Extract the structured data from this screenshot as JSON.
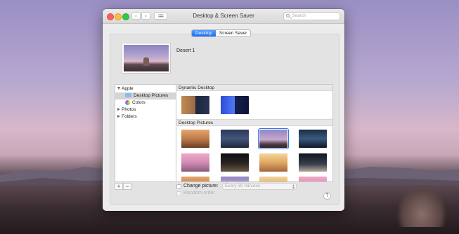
{
  "window": {
    "title": "Desktop & Screen Saver"
  },
  "search": {
    "placeholder": "Search"
  },
  "tabs": [
    {
      "label": "Desktop",
      "active": true
    },
    {
      "label": "Screen Saver",
      "active": false
    }
  ],
  "preview": {
    "name": "Desert 1"
  },
  "sidebar": {
    "groups": [
      {
        "label": "Apple",
        "expanded": true,
        "children": [
          {
            "label": "Desktop Pictures",
            "selected": true
          },
          {
            "label": "Colors"
          }
        ]
      },
      {
        "label": "Photos",
        "expanded": false
      },
      {
        "label": "Folders",
        "expanded": false
      }
    ]
  },
  "sections": {
    "dynamic": {
      "title": "Dynamic Desktop"
    },
    "pictures": {
      "title": "Desktop Pictures"
    }
  },
  "controls": {
    "add_label": "+",
    "remove_label": "−",
    "change_picture_label": "Change picture:",
    "interval": "Every 30 minutes",
    "random_order_label": "Random order",
    "help_label": "?"
  },
  "icons": {
    "back": "chevron-left-icon",
    "forward": "chevron-right-icon",
    "grid": "grid-icon",
    "search": "search-icon",
    "folder": "folder-icon",
    "colors": "color-wheel-icon"
  }
}
